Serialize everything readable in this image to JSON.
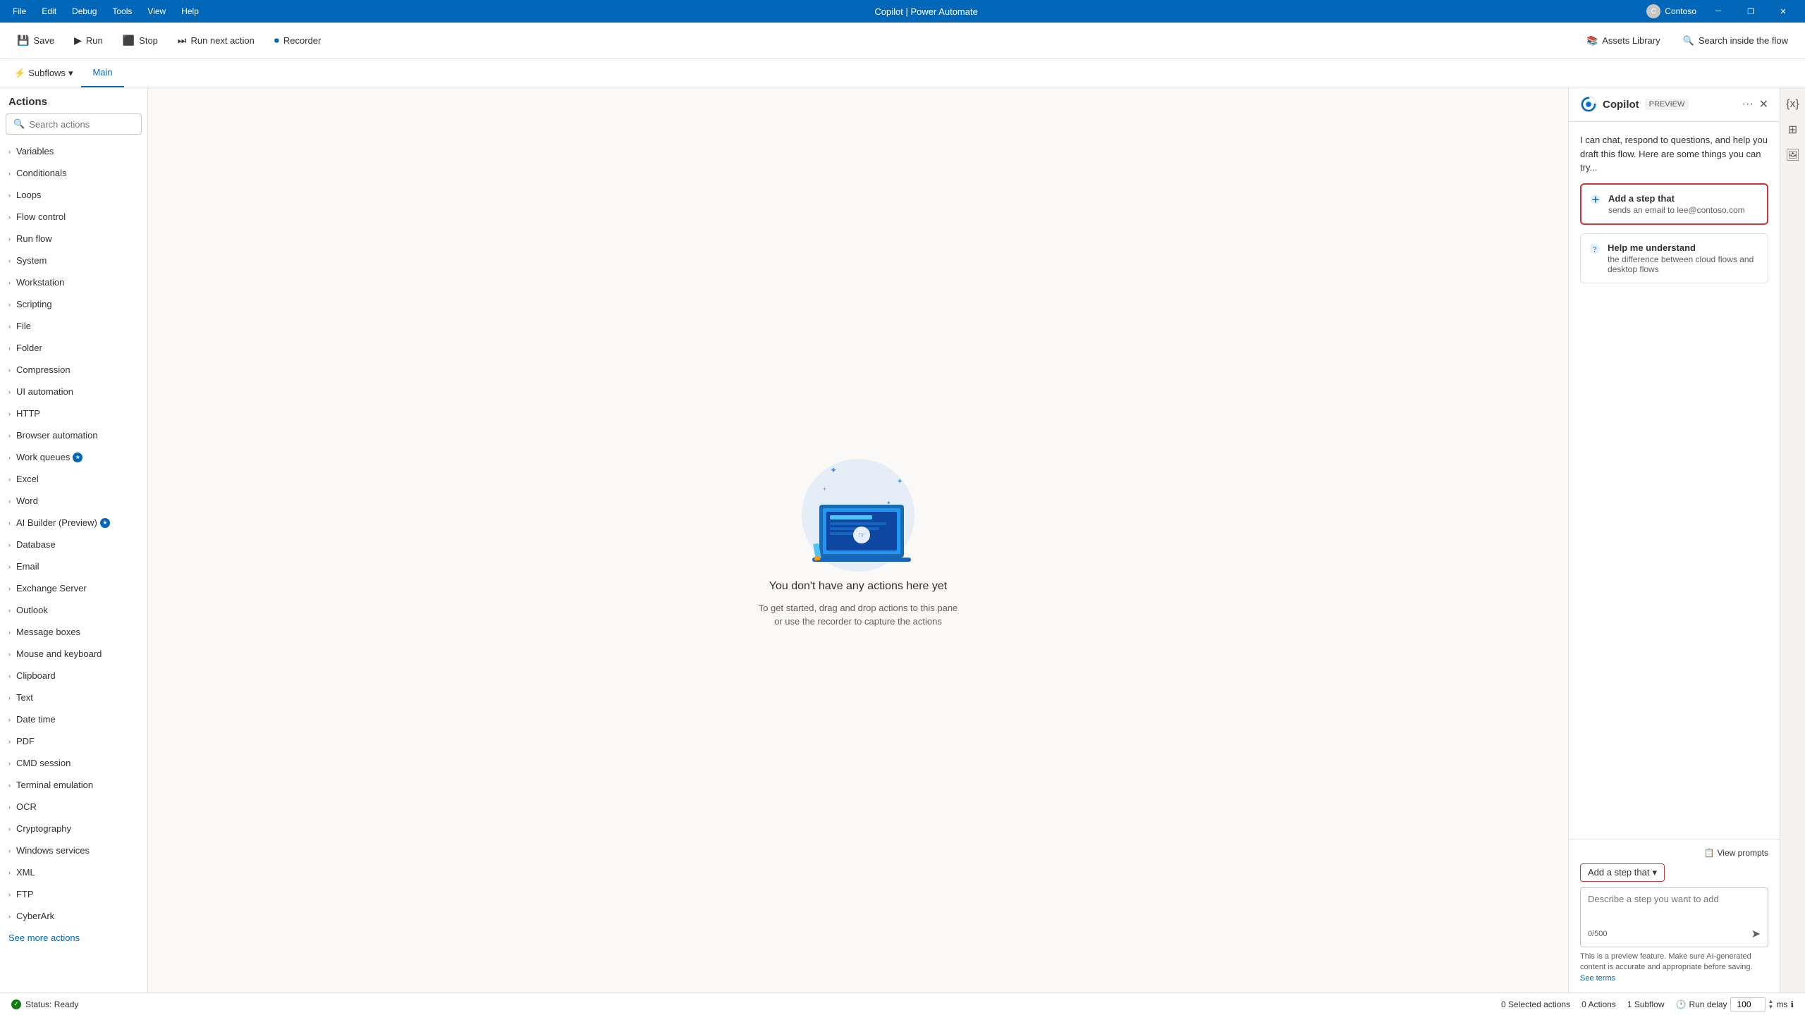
{
  "titlebar": {
    "menu_items": [
      "File",
      "Edit",
      "Debug",
      "Tools",
      "View",
      "Help"
    ],
    "title": "Copilot | Power Automate",
    "user": "Contoso",
    "controls": [
      "─",
      "❐",
      "✕"
    ]
  },
  "toolbar": {
    "save_label": "Save",
    "run_label": "Run",
    "stop_label": "Stop",
    "next_label": "Run next action",
    "recorder_label": "Recorder",
    "assets_label": "Assets Library",
    "search_label": "Search inside the flow"
  },
  "actions": {
    "header": "Actions",
    "search_placeholder": "Search actions",
    "items": [
      {
        "label": "Variables"
      },
      {
        "label": "Conditionals"
      },
      {
        "label": "Loops"
      },
      {
        "label": "Flow control"
      },
      {
        "label": "Run flow"
      },
      {
        "label": "System"
      },
      {
        "label": "Workstation"
      },
      {
        "label": "Scripting"
      },
      {
        "label": "File"
      },
      {
        "label": "Folder"
      },
      {
        "label": "Compression"
      },
      {
        "label": "UI automation"
      },
      {
        "label": "HTTP"
      },
      {
        "label": "Browser automation"
      },
      {
        "label": "Work queues",
        "badge": true
      },
      {
        "label": "Excel"
      },
      {
        "label": "Word"
      },
      {
        "label": "AI Builder (Preview)",
        "badge": true
      },
      {
        "label": "Database"
      },
      {
        "label": "Email"
      },
      {
        "label": "Exchange Server"
      },
      {
        "label": "Outlook"
      },
      {
        "label": "Message boxes"
      },
      {
        "label": "Mouse and keyboard"
      },
      {
        "label": "Clipboard"
      },
      {
        "label": "Text"
      },
      {
        "label": "Date time"
      },
      {
        "label": "PDF"
      },
      {
        "label": "CMD session"
      },
      {
        "label": "Terminal emulation"
      },
      {
        "label": "OCR"
      },
      {
        "label": "Cryptography"
      },
      {
        "label": "Windows services"
      },
      {
        "label": "XML"
      },
      {
        "label": "FTP"
      },
      {
        "label": "CyberArk"
      }
    ],
    "see_more": "See more actions"
  },
  "tabs": {
    "subflows_label": "Subflows",
    "main_label": "Main"
  },
  "canvas": {
    "empty_title": "You don't have any actions here yet",
    "empty_sub1": "To get started, drag and drop actions to this pane",
    "empty_sub2": "or use the recorder to capture the actions"
  },
  "copilot": {
    "title": "Copilot",
    "preview_badge": "PREVIEW",
    "intro": "I can chat, respond to questions, and help you draft this flow. Here are some things you can try...",
    "suggestions": [
      {
        "id": "add-step",
        "title": "Add a step that",
        "sub": "sends an email to lee@contoso.com",
        "highlighted": true
      },
      {
        "id": "help-understand",
        "title": "Help me understand",
        "sub": "the difference between cloud flows and desktop flows",
        "highlighted": false
      }
    ],
    "view_prompts": "View prompts",
    "add_step_selector": "Add a step that",
    "input_placeholder": "Describe a step you want to add",
    "char_count": "0/500",
    "disclaimer": "This is a preview feature. Make sure AI-generated content is accurate and appropriate before saving.",
    "see_terms": "See terms"
  },
  "statusbar": {
    "status_label": "Status: Ready",
    "selected_actions": "0 Selected actions",
    "actions_count": "0 Actions",
    "subflow_count": "1 Subflow",
    "run_delay_label": "Run delay",
    "run_delay_value": "100",
    "ms_label": "ms"
  }
}
